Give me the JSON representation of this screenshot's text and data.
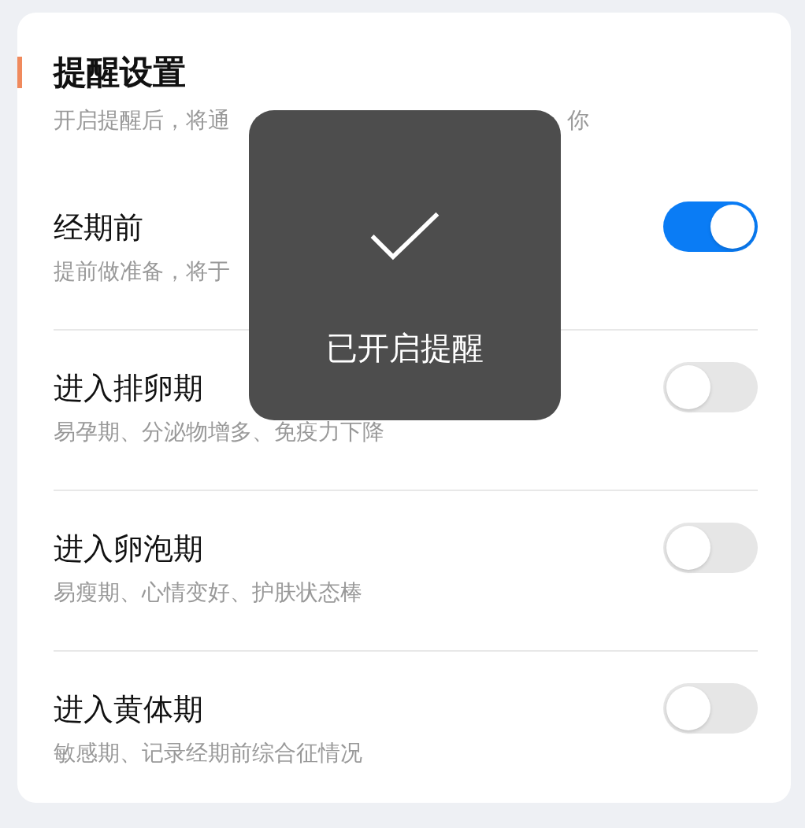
{
  "section": {
    "title": "提醒设置",
    "subtitle_parts": [
      "开启提醒后，将通",
      "你"
    ]
  },
  "settings": [
    {
      "title": "经期前",
      "description": "提前做准备，将于",
      "on": true
    },
    {
      "title": "进入排卵期",
      "description": "易孕期、分泌物增多、免疫力下降",
      "on": false
    },
    {
      "title": "进入卵泡期",
      "description": "易瘦期、心情变好、护肤状态棒",
      "on": false
    },
    {
      "title": "进入黄体期",
      "description": "敏感期、记录经期前综合征情况",
      "on": false
    }
  ],
  "toast": {
    "message": "已开启提醒"
  }
}
